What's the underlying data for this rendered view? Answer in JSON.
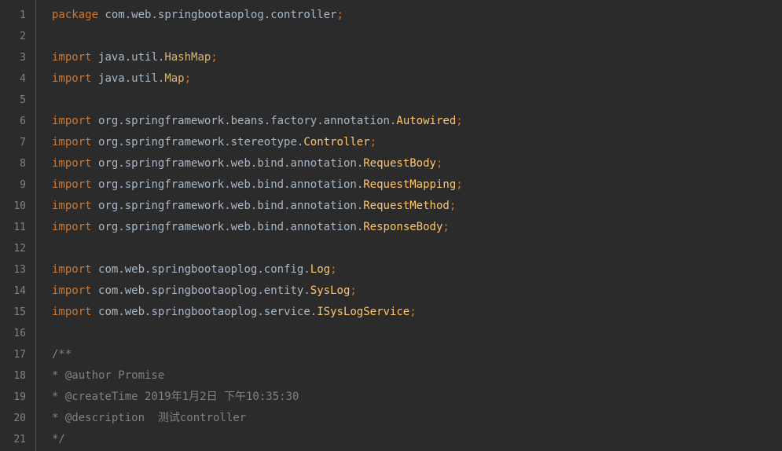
{
  "lines": [
    {
      "num": 1,
      "tokens": [
        {
          "t": "package ",
          "c": "kw"
        },
        {
          "t": "com",
          "c": "ns"
        },
        {
          "t": ".",
          "c": "punc"
        },
        {
          "t": "web",
          "c": "ns"
        },
        {
          "t": ".",
          "c": "punc"
        },
        {
          "t": "springbootaoplog",
          "c": "ns"
        },
        {
          "t": ".",
          "c": "punc"
        },
        {
          "t": "controller",
          "c": "ns"
        },
        {
          "t": ";",
          "c": "semi"
        }
      ]
    },
    {
      "num": 2,
      "tokens": []
    },
    {
      "num": 3,
      "tokens": [
        {
          "t": "import ",
          "c": "kw"
        },
        {
          "t": "java",
          "c": "ns"
        },
        {
          "t": ".",
          "c": "punc"
        },
        {
          "t": "util",
          "c": "ns"
        },
        {
          "t": ".",
          "c": "punc"
        },
        {
          "t": "HashMap",
          "c": "cls"
        },
        {
          "t": ";",
          "c": "semi"
        }
      ]
    },
    {
      "num": 4,
      "tokens": [
        {
          "t": "import ",
          "c": "kw"
        },
        {
          "t": "java",
          "c": "ns"
        },
        {
          "t": ".",
          "c": "punc"
        },
        {
          "t": "util",
          "c": "ns"
        },
        {
          "t": ".",
          "c": "punc"
        },
        {
          "t": "Map",
          "c": "cls"
        },
        {
          "t": ";",
          "c": "semi"
        }
      ]
    },
    {
      "num": 5,
      "tokens": []
    },
    {
      "num": 6,
      "tokens": [
        {
          "t": "import ",
          "c": "kw"
        },
        {
          "t": "org",
          "c": "ns"
        },
        {
          "t": ".",
          "c": "punc"
        },
        {
          "t": "springframework",
          "c": "ns"
        },
        {
          "t": ".",
          "c": "punc"
        },
        {
          "t": "beans",
          "c": "ns"
        },
        {
          "t": ".",
          "c": "punc"
        },
        {
          "t": "factory",
          "c": "ns"
        },
        {
          "t": ".",
          "c": "punc"
        },
        {
          "t": "annotation",
          "c": "ns"
        },
        {
          "t": ".",
          "c": "punc"
        },
        {
          "t": "Autowired",
          "c": "cls-y"
        },
        {
          "t": ";",
          "c": "semi"
        }
      ]
    },
    {
      "num": 7,
      "tokens": [
        {
          "t": "import ",
          "c": "kw"
        },
        {
          "t": "org",
          "c": "ns"
        },
        {
          "t": ".",
          "c": "punc"
        },
        {
          "t": "springframework",
          "c": "ns"
        },
        {
          "t": ".",
          "c": "punc"
        },
        {
          "t": "stereotype",
          "c": "ns"
        },
        {
          "t": ".",
          "c": "punc"
        },
        {
          "t": "Controller",
          "c": "cls-y"
        },
        {
          "t": ";",
          "c": "semi"
        }
      ]
    },
    {
      "num": 8,
      "tokens": [
        {
          "t": "import ",
          "c": "kw"
        },
        {
          "t": "org",
          "c": "ns"
        },
        {
          "t": ".",
          "c": "punc"
        },
        {
          "t": "springframework",
          "c": "ns"
        },
        {
          "t": ".",
          "c": "punc"
        },
        {
          "t": "web",
          "c": "ns"
        },
        {
          "t": ".",
          "c": "punc"
        },
        {
          "t": "bind",
          "c": "ns"
        },
        {
          "t": ".",
          "c": "punc"
        },
        {
          "t": "annotation",
          "c": "ns"
        },
        {
          "t": ".",
          "c": "punc"
        },
        {
          "t": "RequestBody",
          "c": "cls-y"
        },
        {
          "t": ";",
          "c": "semi"
        }
      ]
    },
    {
      "num": 9,
      "tokens": [
        {
          "t": "import ",
          "c": "kw"
        },
        {
          "t": "org",
          "c": "ns"
        },
        {
          "t": ".",
          "c": "punc"
        },
        {
          "t": "springframework",
          "c": "ns"
        },
        {
          "t": ".",
          "c": "punc"
        },
        {
          "t": "web",
          "c": "ns"
        },
        {
          "t": ".",
          "c": "punc"
        },
        {
          "t": "bind",
          "c": "ns"
        },
        {
          "t": ".",
          "c": "punc"
        },
        {
          "t": "annotation",
          "c": "ns"
        },
        {
          "t": ".",
          "c": "punc"
        },
        {
          "t": "RequestMapping",
          "c": "cls-y"
        },
        {
          "t": ";",
          "c": "semi"
        }
      ]
    },
    {
      "num": 10,
      "tokens": [
        {
          "t": "import ",
          "c": "kw"
        },
        {
          "t": "org",
          "c": "ns"
        },
        {
          "t": ".",
          "c": "punc"
        },
        {
          "t": "springframework",
          "c": "ns"
        },
        {
          "t": ".",
          "c": "punc"
        },
        {
          "t": "web",
          "c": "ns"
        },
        {
          "t": ".",
          "c": "punc"
        },
        {
          "t": "bind",
          "c": "ns"
        },
        {
          "t": ".",
          "c": "punc"
        },
        {
          "t": "annotation",
          "c": "ns"
        },
        {
          "t": ".",
          "c": "punc"
        },
        {
          "t": "RequestMethod",
          "c": "cls-y"
        },
        {
          "t": ";",
          "c": "semi"
        }
      ]
    },
    {
      "num": 11,
      "tokens": [
        {
          "t": "import ",
          "c": "kw"
        },
        {
          "t": "org",
          "c": "ns"
        },
        {
          "t": ".",
          "c": "punc"
        },
        {
          "t": "springframework",
          "c": "ns"
        },
        {
          "t": ".",
          "c": "punc"
        },
        {
          "t": "web",
          "c": "ns"
        },
        {
          "t": ".",
          "c": "punc"
        },
        {
          "t": "bind",
          "c": "ns"
        },
        {
          "t": ".",
          "c": "punc"
        },
        {
          "t": "annotation",
          "c": "ns"
        },
        {
          "t": ".",
          "c": "punc"
        },
        {
          "t": "ResponseBody",
          "c": "cls-y"
        },
        {
          "t": ";",
          "c": "semi"
        }
      ]
    },
    {
      "num": 12,
      "tokens": []
    },
    {
      "num": 13,
      "tokens": [
        {
          "t": "import ",
          "c": "kw"
        },
        {
          "t": "com",
          "c": "ns"
        },
        {
          "t": ".",
          "c": "punc"
        },
        {
          "t": "web",
          "c": "ns"
        },
        {
          "t": ".",
          "c": "punc"
        },
        {
          "t": "springbootaoplog",
          "c": "ns"
        },
        {
          "t": ".",
          "c": "punc"
        },
        {
          "t": "config",
          "c": "ns"
        },
        {
          "t": ".",
          "c": "punc"
        },
        {
          "t": "Log",
          "c": "cls-y"
        },
        {
          "t": ";",
          "c": "semi"
        }
      ]
    },
    {
      "num": 14,
      "tokens": [
        {
          "t": "import ",
          "c": "kw"
        },
        {
          "t": "com",
          "c": "ns"
        },
        {
          "t": ".",
          "c": "punc"
        },
        {
          "t": "web",
          "c": "ns"
        },
        {
          "t": ".",
          "c": "punc"
        },
        {
          "t": "springbootaoplog",
          "c": "ns"
        },
        {
          "t": ".",
          "c": "punc"
        },
        {
          "t": "entity",
          "c": "ns"
        },
        {
          "t": ".",
          "c": "punc"
        },
        {
          "t": "SysLog",
          "c": "cls-y"
        },
        {
          "t": ";",
          "c": "semi"
        }
      ]
    },
    {
      "num": 15,
      "tokens": [
        {
          "t": "import ",
          "c": "kw"
        },
        {
          "t": "com",
          "c": "ns"
        },
        {
          "t": ".",
          "c": "punc"
        },
        {
          "t": "web",
          "c": "ns"
        },
        {
          "t": ".",
          "c": "punc"
        },
        {
          "t": "springbootaoplog",
          "c": "ns"
        },
        {
          "t": ".",
          "c": "punc"
        },
        {
          "t": "service",
          "c": "ns"
        },
        {
          "t": ".",
          "c": "punc"
        },
        {
          "t": "ISysLogService",
          "c": "cls-y"
        },
        {
          "t": ";",
          "c": "semi"
        }
      ]
    },
    {
      "num": 16,
      "tokens": []
    },
    {
      "num": 17,
      "tokens": [
        {
          "t": "/**",
          "c": "cmt"
        }
      ]
    },
    {
      "num": 18,
      "tokens": [
        {
          "t": "* @author Promise",
          "c": "cmt"
        }
      ]
    },
    {
      "num": 19,
      "tokens": [
        {
          "t": "* @createTime 2019年1月2日 下午10:35:30",
          "c": "cmt"
        }
      ]
    },
    {
      "num": 20,
      "tokens": [
        {
          "t": "* @description  测试controller",
          "c": "cmt"
        }
      ]
    },
    {
      "num": 21,
      "tokens": [
        {
          "t": "*/",
          "c": "cmt"
        }
      ]
    }
  ]
}
